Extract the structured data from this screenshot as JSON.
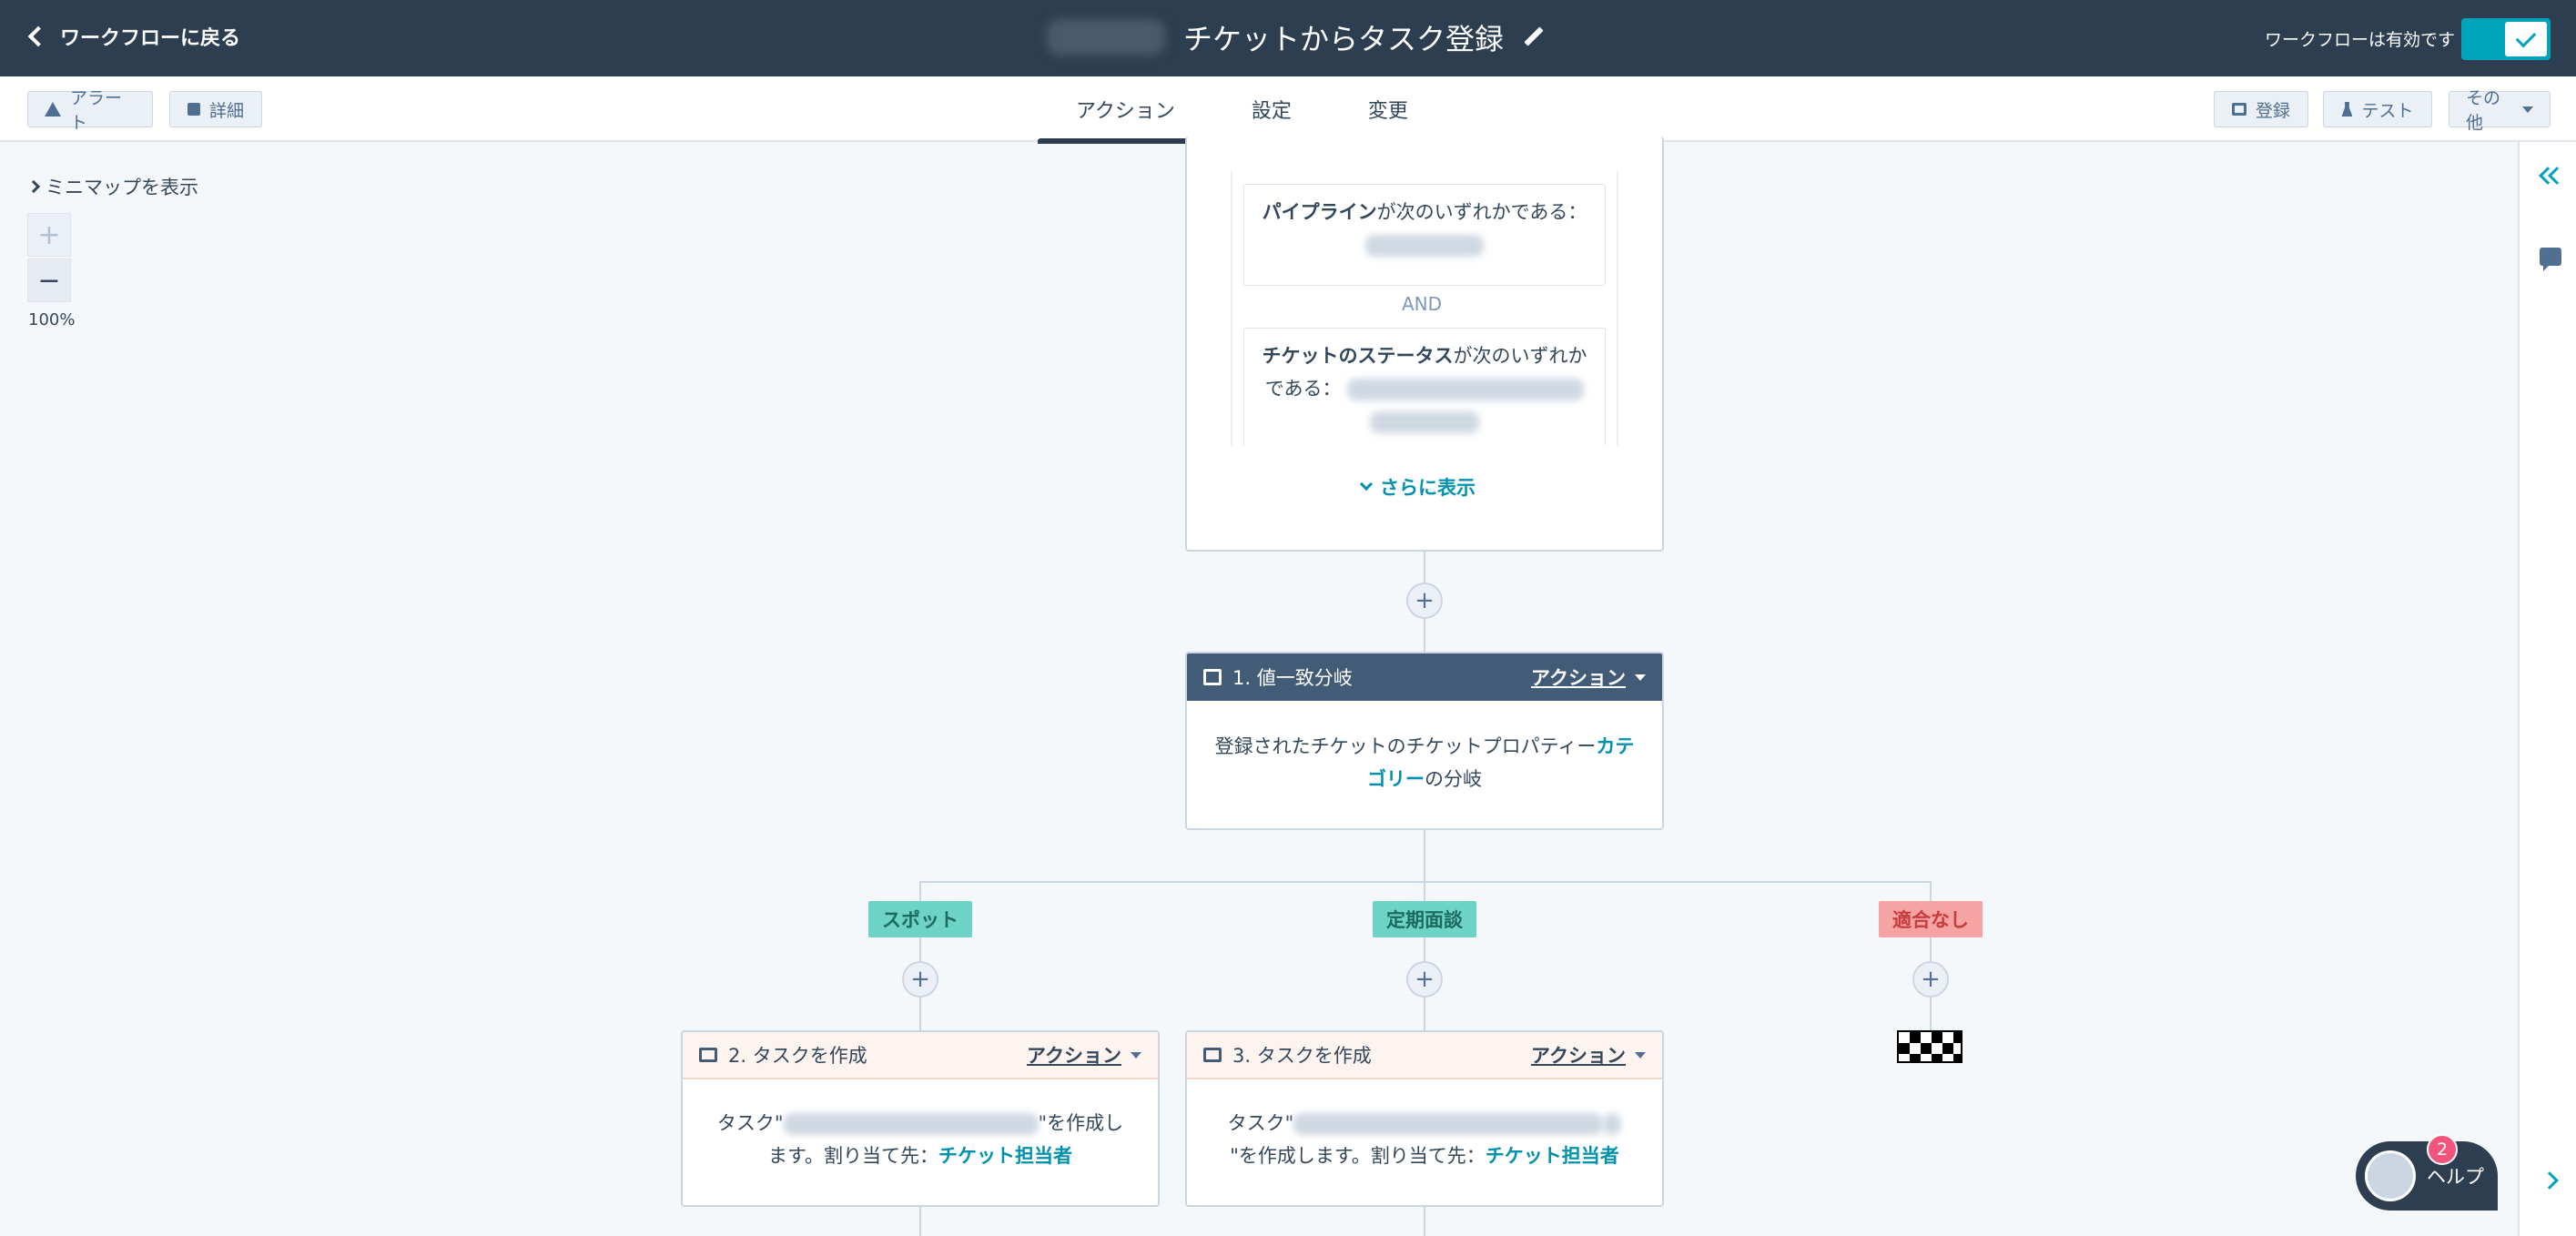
{
  "header": {
    "back_label": "ワークフローに戻る",
    "title": "チケットからタスク登録",
    "status_text": "ワークフローは有効です"
  },
  "toolbar": {
    "alert_label": "アラート",
    "details_label": "詳細",
    "enroll_label": "登録",
    "test_label": "テスト",
    "more_label": "その他"
  },
  "tabs": [
    {
      "label": "アクション",
      "active": true
    },
    {
      "label": "設定",
      "active": false
    },
    {
      "label": "変更",
      "active": false
    }
  ],
  "canvas_controls": {
    "minimap_label": "ミニマップを表示",
    "zoom_in": "+",
    "zoom_out": "−",
    "zoom_level": "100%"
  },
  "trigger": {
    "filter1_prop": "パイプライン",
    "filter1_text": "が次のいずれかである：",
    "and_label": "AND",
    "filter2_prop": "チケットのステータス",
    "filter2_text": "が次のいずれかである：",
    "show_more": "さらに表示"
  },
  "branch_action": {
    "title": "1. 値一致分岐",
    "menu": "アクション",
    "body_prefix": "登録されたチケットのチケットプロパティー",
    "body_link": "カテゴリー",
    "body_suffix": "の分岐"
  },
  "branches": [
    {
      "label": "スポット",
      "color": "#6dd3c6"
    },
    {
      "label": "定期面談",
      "color": "#6dd3c6"
    },
    {
      "label": "適合なし",
      "color": "#f5a3a3"
    }
  ],
  "task_actions": [
    {
      "title": "2. タスクを作成",
      "menu": "アクション",
      "body_prefix": "タスク\"",
      "body_suffix": "\"を作成します。割り当て先：",
      "body_link": "チケット担当者"
    },
    {
      "title": "3. タスクを作成",
      "menu": "アクション",
      "body_prefix": "タスク\"",
      "body_suffix": "\"を作成します。割り当て先：",
      "body_link": "チケット担当者"
    }
  ],
  "plus_label": "+",
  "help": {
    "label": "ヘルプ",
    "badge": "2"
  },
  "colors": {
    "header_bg": "#2d3e50",
    "accent": "#00a4bd",
    "link": "#0091ae",
    "action_header": "#425b76"
  }
}
